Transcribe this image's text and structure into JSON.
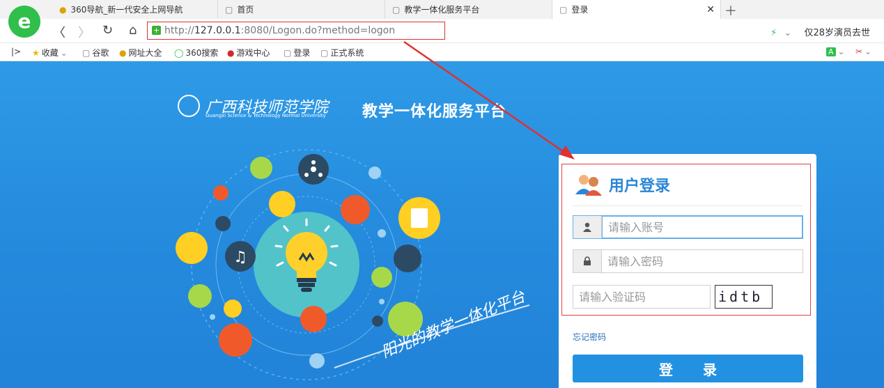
{
  "browser": {
    "tabs": [
      {
        "label": "360导航_新一代安全上网导航"
      },
      {
        "label": "首页"
      },
      {
        "label": "教学一体化服务平台"
      },
      {
        "label": "登录"
      }
    ],
    "address": {
      "scheme": "http://",
      "host": "127.0.0.1",
      "rest": ":8080/Logon.do?method=logon"
    },
    "news_text": "仅28岁演员去世",
    "bookmarks": [
      {
        "label": "收藏"
      },
      {
        "label": "谷歌"
      },
      {
        "label": "网址大全"
      },
      {
        "label": "360搜索"
      },
      {
        "label": "游戏中心"
      },
      {
        "label": "登录"
      },
      {
        "label": "正式系统"
      }
    ]
  },
  "page": {
    "school_name": "广西科技师范学院",
    "school_name_en": "Guangxi Science & Technology Normal University",
    "platform_name": "教学一体化服务平台",
    "slogan": "阳光的教学一体化平台"
  },
  "login": {
    "title": "用户登录",
    "username_placeholder": "请输入账号",
    "password_placeholder": "请输入密码",
    "captcha_placeholder": "请输入验证码",
    "captcha_text": "idtb",
    "forgot_label": "忘记密码",
    "submit_label": "登 录"
  },
  "colors": {
    "accent": "#2391e2",
    "highlight": "#e04040"
  }
}
